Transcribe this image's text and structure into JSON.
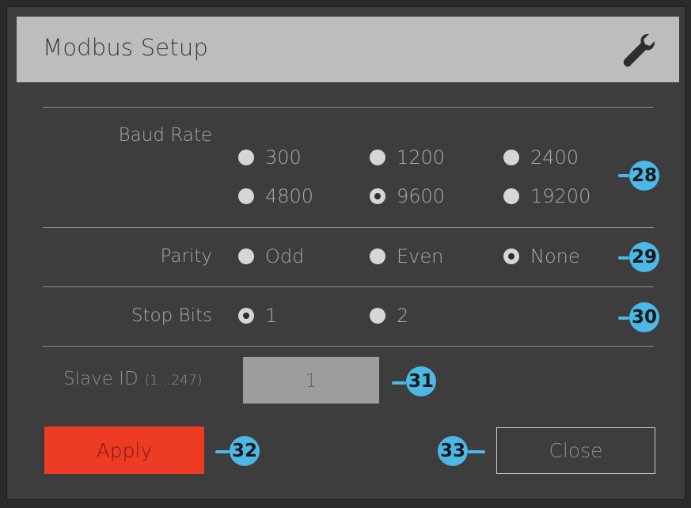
{
  "dialog": {
    "title": "Modbus Setup",
    "title_icon": "wrench-icon"
  },
  "baud_rate": {
    "label": "Baud Rate",
    "options": [
      "300",
      "1200",
      "2400",
      "4800",
      "9600",
      "19200"
    ],
    "selected": "9600",
    "badge": "28"
  },
  "parity": {
    "label": "Parity",
    "options": [
      "Odd",
      "Even",
      "None"
    ],
    "selected": "None",
    "badge": "29"
  },
  "stop_bits": {
    "label": "Stop Bits",
    "options": [
      "1",
      "2"
    ],
    "selected": "1",
    "badge": "30"
  },
  "slave_id": {
    "label": "Slave ID",
    "range": "(1...247)",
    "value": "1",
    "badge": "31"
  },
  "buttons": {
    "apply_label": "Apply",
    "apply_badge": "32",
    "close_label": "Close",
    "close_badge": "33"
  },
  "colors": {
    "apply": "#ee3b24",
    "badge": "#4cb8e6",
    "panel": "#3d3d3d",
    "titlebar": "#bdbdbd"
  }
}
